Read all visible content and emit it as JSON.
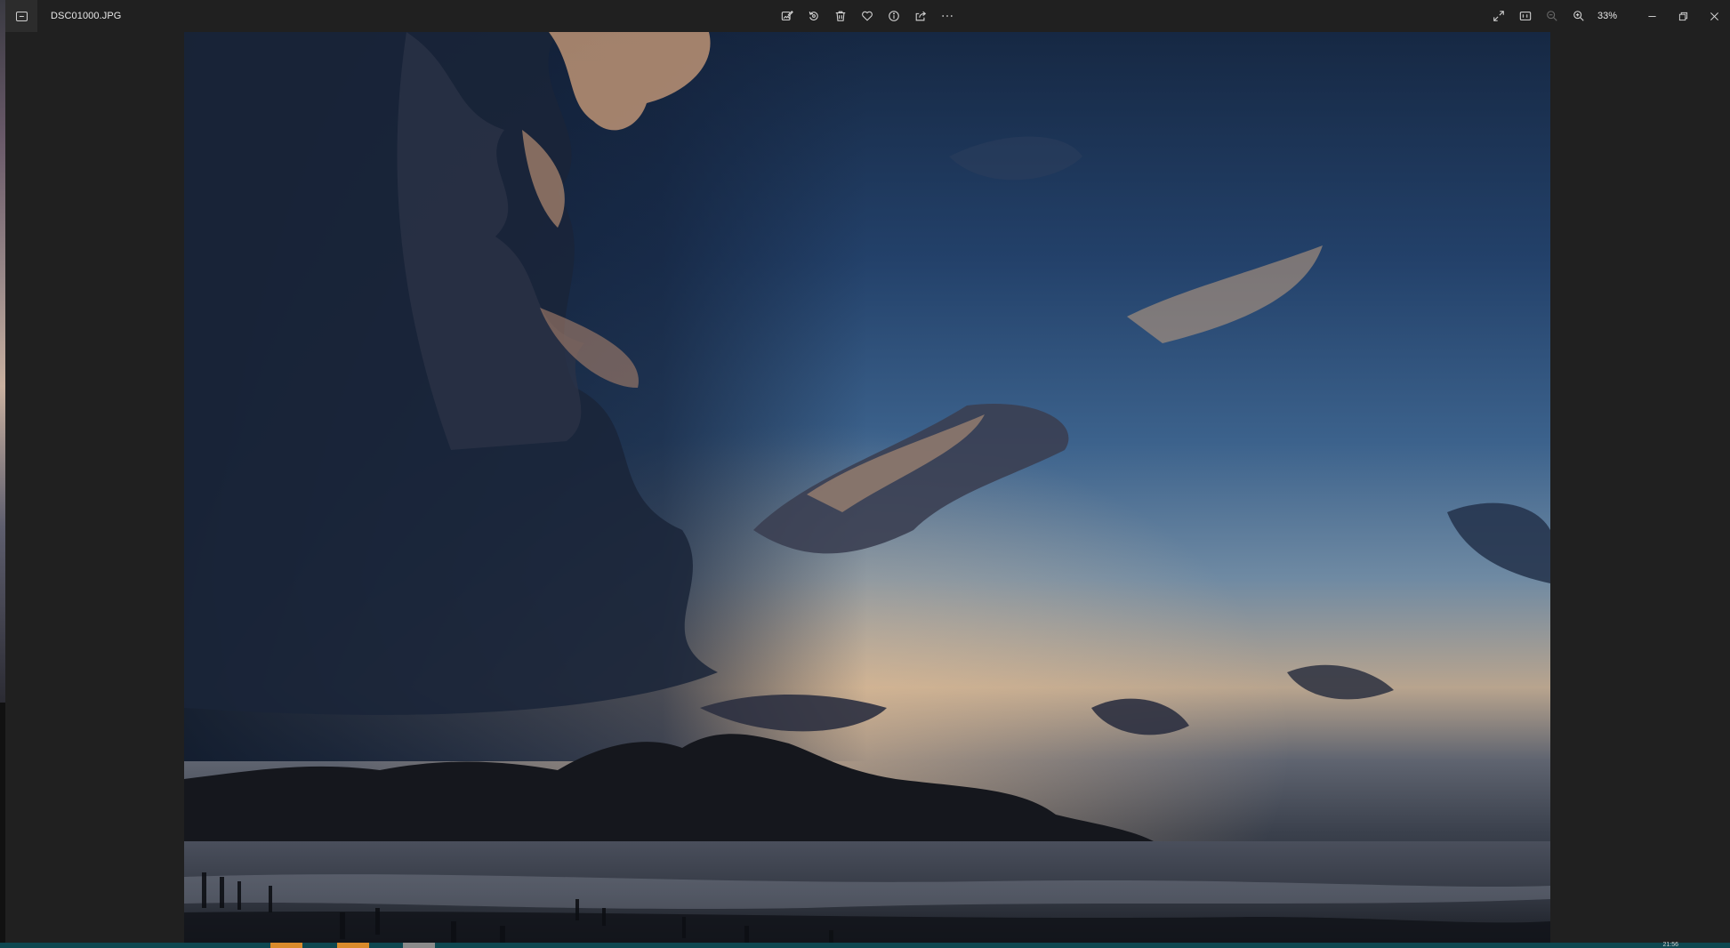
{
  "window": {
    "file_name": "DSC01000.JPG"
  },
  "toolbar": {
    "buttons": [
      {
        "name": "edit-image",
        "icon": "edit-image-icon"
      },
      {
        "name": "rotate",
        "icon": "rotate-icon"
      },
      {
        "name": "delete",
        "icon": "trash-icon"
      },
      {
        "name": "favorite",
        "icon": "heart-icon"
      },
      {
        "name": "file-info",
        "icon": "info-icon"
      },
      {
        "name": "share",
        "icon": "share-icon"
      },
      {
        "name": "see-more",
        "icon": "more-icon"
      }
    ]
  },
  "view": {
    "zoom_level": "33%",
    "zoom_out_enabled": false
  },
  "taskbar": {
    "time_fragment": "21:56"
  },
  "colors": {
    "background": "#202020",
    "titlebar": "#202020",
    "icon_box": "#2c2c2c",
    "filmstrip": "#0e4750",
    "thumb_orange": "#d98a2b",
    "thumb_gray": "#8a8a8a"
  }
}
